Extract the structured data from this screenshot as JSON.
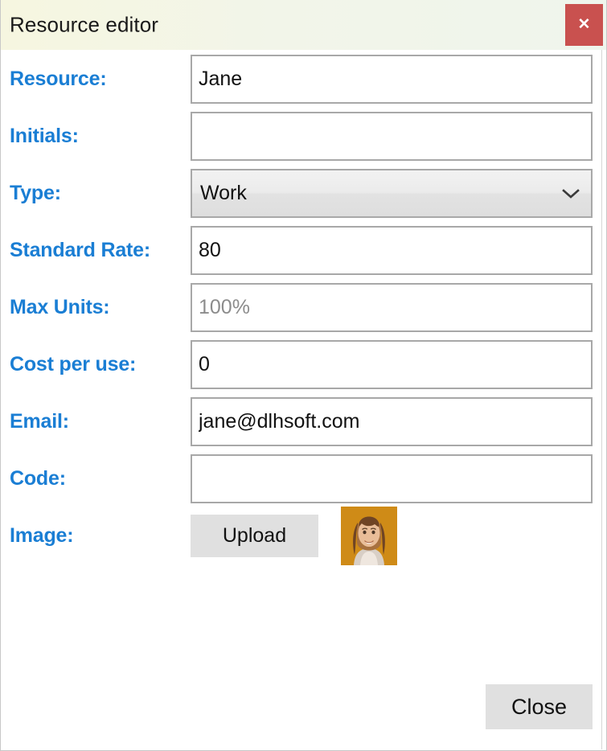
{
  "window": {
    "title": "Resource editor",
    "close_icon_label": "✕",
    "accent_label_color": "#1a7ed4",
    "close_button_color": "#c9514f"
  },
  "form": {
    "fields": [
      {
        "label": "Resource:",
        "value": "Jane",
        "placeholder": "",
        "type": "text"
      },
      {
        "label": "Initials:",
        "value": "",
        "placeholder": "",
        "type": "text"
      },
      {
        "label": "Type:",
        "value": "Work",
        "placeholder": "",
        "type": "select"
      },
      {
        "label": "Standard Rate:",
        "value": "80",
        "placeholder": "",
        "type": "text"
      },
      {
        "label": "Max Units:",
        "value": "",
        "placeholder": "100%",
        "type": "text"
      },
      {
        "label": "Cost per use:",
        "value": "0",
        "placeholder": "",
        "type": "text"
      },
      {
        "label": "Email:",
        "value": "jane@dlhsoft.com",
        "placeholder": "",
        "type": "text"
      },
      {
        "label": "Code:",
        "value": "",
        "placeholder": "",
        "type": "text"
      }
    ],
    "image_row": {
      "label": "Image:",
      "upload_label": "Upload",
      "avatar_alt": "resource-portrait",
      "avatar_background": "#cf8b17"
    }
  },
  "footer": {
    "close_label": "Close"
  }
}
